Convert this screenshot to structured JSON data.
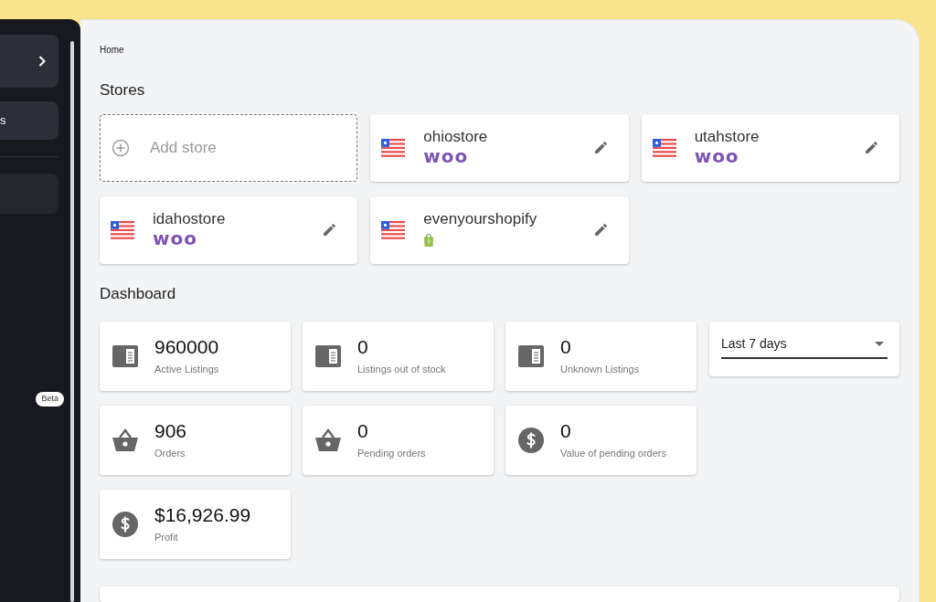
{
  "sidebar": {
    "items": [
      {
        "kind": "chevron"
      },
      {
        "label": "s",
        "kind": "text"
      },
      {
        "kind": "blank"
      }
    ],
    "badge": "Beta"
  },
  "breadcrumb": "Home",
  "stores": {
    "title": "Stores",
    "add_label": "Add store",
    "items": [
      {
        "name": "ohiostore",
        "kind": "woo",
        "logo": "woo"
      },
      {
        "name": "utahstore",
        "kind": "woo",
        "logo": "woo"
      },
      {
        "name": "idahostore",
        "kind": "woo",
        "logo": "woo"
      },
      {
        "name": "evenyourshopify",
        "kind": "shopify"
      }
    ]
  },
  "dashboard": {
    "title": "Dashboard",
    "period": "Last 7 days",
    "stats": [
      {
        "value": "960000",
        "label": "Active Listings",
        "kind": "listing"
      },
      {
        "value": "0",
        "label": "Listings out of stock",
        "kind": "listing"
      },
      {
        "value": "0",
        "label": "Unknown Listings",
        "kind": "listing"
      },
      {
        "value": "906",
        "label": "Orders",
        "kind": "basket"
      },
      {
        "value": "0",
        "label": "Pending orders",
        "kind": "basket"
      },
      {
        "value": "0",
        "label": "Value of pending orders",
        "kind": "dollar"
      },
      {
        "value": "$16,926.99",
        "label": "Profit",
        "kind": "dollar"
      }
    ]
  }
}
